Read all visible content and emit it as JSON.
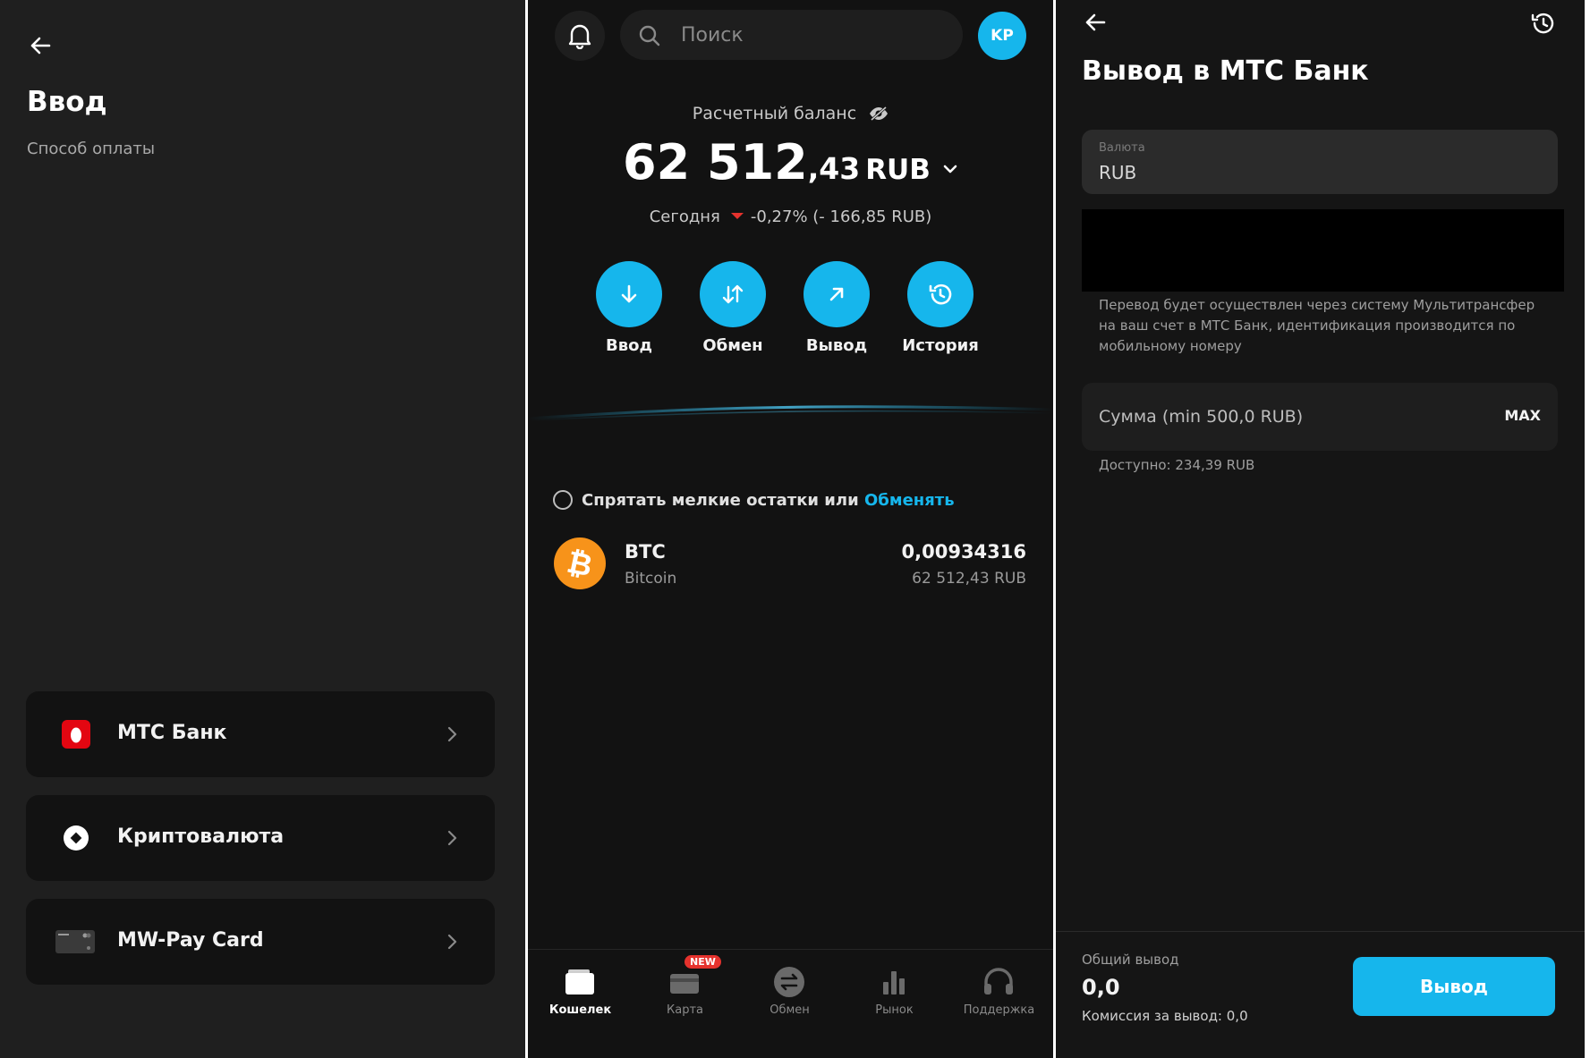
{
  "deposit_screen": {
    "title": "Ввод",
    "subtitle": "Способ оплаты",
    "methods": [
      {
        "label": "МТС Банк",
        "icon": "mts-logo-icon"
      },
      {
        "label": "Криптовалюта",
        "icon": "crypto-icon"
      },
      {
        "label": "MW-Pay Card",
        "icon": "card-icon"
      }
    ]
  },
  "wallet_screen": {
    "search_placeholder": "Поиск",
    "avatar_initials": "KP",
    "balance_label": "Расчетный баланс",
    "balance_int": "62 512",
    "balance_frac": ",43",
    "balance_currency": "RUB",
    "today_label": "Сегодня",
    "today_change": "-0,27% (- 166,85 RUB)",
    "actions": [
      {
        "label": "Ввод",
        "icon": "arrow-down-icon"
      },
      {
        "label": "Обмен",
        "icon": "swap-icon"
      },
      {
        "label": "Вывод",
        "icon": "arrow-up-right-icon"
      },
      {
        "label": "История",
        "icon": "history-icon"
      }
    ],
    "hide_small_text": "Спрятать мелкие остатки или",
    "hide_small_link": "Обменять",
    "assets": [
      {
        "symbol": "BTC",
        "name": "Bitcoin",
        "amount": "0,00934316",
        "value_rub": "62 512,43 RUB"
      }
    ],
    "nav": [
      {
        "label": "Кошелек",
        "icon": "wallet-icon",
        "active": true
      },
      {
        "label": "Карта",
        "icon": "card-icon",
        "badge": "NEW"
      },
      {
        "label": "Обмен",
        "icon": "exchange-icon"
      },
      {
        "label": "Рынок",
        "icon": "market-icon"
      },
      {
        "label": "Поддержка",
        "icon": "headset-icon"
      }
    ]
  },
  "withdraw_screen": {
    "title": "Вывод в МТС Банк",
    "currency_label": "Валюта",
    "currency_value": "RUB",
    "note": "Перевод будет осуществлен через систему Мультитрансфер на ваш счет в МТС Банк, идентификация производится по мобильному номеру",
    "amount_placeholder": "Сумма (min 500,0 RUB)",
    "max_label": "MAX",
    "available": "Доступно: 234,39 RUB",
    "total_label": "Общий вывод",
    "total_value": "0,0",
    "fee_text": "Комиссия за вывод: 0,0",
    "submit_label": "Вывод"
  },
  "colors": {
    "accent": "#16b6ec",
    "negative": "#e5322d",
    "mts_red": "#e30611",
    "btc_orange": "#f7931a"
  }
}
